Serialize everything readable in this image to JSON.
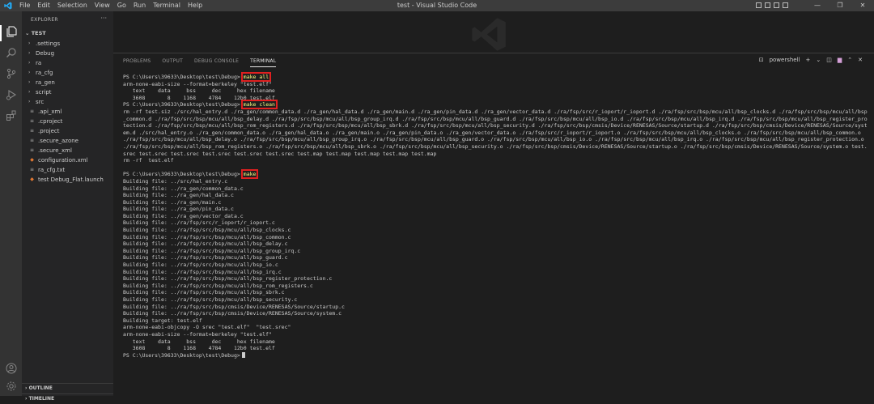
{
  "titlebar": {
    "menu": [
      "File",
      "Edit",
      "Selection",
      "View",
      "Go",
      "Run",
      "Terminal",
      "Help"
    ],
    "title": "test - Visual Studio Code",
    "controls": [
      "—",
      "❐",
      "✕"
    ]
  },
  "activity": {
    "icons": [
      "explorer-icon",
      "search-icon",
      "source-control-icon",
      "run-debug-icon",
      "extensions-icon",
      "accounts-icon",
      "manage-icon"
    ]
  },
  "sidebar": {
    "title": "EXPLORER",
    "more": "···",
    "section": "TEST",
    "items": [
      {
        "label": ".settings",
        "type": "folder"
      },
      {
        "label": "Debug",
        "type": "folder"
      },
      {
        "label": "ra",
        "type": "folder"
      },
      {
        "label": "ra_cfg",
        "type": "folder"
      },
      {
        "label": "ra_gen",
        "type": "folder"
      },
      {
        "label": "script",
        "type": "folder"
      },
      {
        "label": "src",
        "type": "folder"
      },
      {
        "label": ".api_xml",
        "type": "file"
      },
      {
        "label": ".cproject",
        "type": "file"
      },
      {
        "label": ".project",
        "type": "file"
      },
      {
        "label": ".secure_azone",
        "type": "file"
      },
      {
        "label": ".secure_xml",
        "type": "file"
      },
      {
        "label": "configuration.xml",
        "type": "xml"
      },
      {
        "label": "ra_cfg.txt",
        "type": "txt"
      },
      {
        "label": "test Debug_Flat.launch",
        "type": "launch"
      }
    ],
    "outline": "OUTLINE",
    "timeline": "TIMELINE"
  },
  "panel": {
    "tabs": [
      "PROBLEMS",
      "OUTPUT",
      "DEBUG CONSOLE",
      "TERMINAL"
    ],
    "active_tab": "TERMINAL",
    "shell": "powershell",
    "prompt": "PS C:\\Users\\39633\\Desktop\\test\\Debug>",
    "cmd1": "make all",
    "out1": [
      "arm-none-eabi-size --format=berkeley \"test.elf\"",
      "   text    data     bss     dec     hex filename",
      "   3608       8    1168    4784    12b0 test.elf"
    ],
    "cmd2": "make clean",
    "clean_output": "rm -rf test.siz ./src/hal_entry.d ./ra_gen/common_data.d ./ra_gen/hal_data.d ./ra_gen/main.d ./ra_gen/pin_data.d ./ra_gen/vector_data.d ./ra/fsp/src/r_ioport/r_ioport.d ./ra/fsp/src/bsp/mcu/all/bsp_clocks.d ./ra/fsp/src/bsp/mcu/all/bsp_common.d ./ra/fsp/src/bsp/mcu/all/bsp_delay.d ./ra/fsp/src/bsp/mcu/all/bsp_group_irq.d ./ra/fsp/src/bsp/mcu/all/bsp_guard.d ./ra/fsp/src/bsp/mcu/all/bsp_io.d ./ra/fsp/src/bsp/mcu/all/bsp_irq.d ./ra/fsp/src/bsp/mcu/all/bsp_register_protection.d ./ra/fsp/src/bsp/mcu/all/bsp_rom_registers.d ./ra/fsp/src/bsp/mcu/all/bsp_sbrk.d ./ra/fsp/src/bsp/mcu/all/bsp_security.d ./ra/fsp/src/bsp/cmsis/Device/RENESAS/Source/startup.d ./ra/fsp/src/bsp/cmsis/Device/RENESAS/Source/system.d ./src/hal_entry.o ./ra_gen/common_data.o ./ra_gen/hal_data.o ./ra_gen/main.o ./ra_gen/pin_data.o ./ra_gen/vector_data.o ./ra/fsp/src/r_ioport/r_ioport.o ./ra/fsp/src/bsp/mcu/all/bsp_clocks.o ./ra/fsp/src/bsp/mcu/all/bsp_common.o ./ra/fsp/src/bsp/mcu/all/bsp_delay.o ./ra/fsp/src/bsp/mcu/all/bsp_group_irq.o ./ra/fsp/src/bsp/mcu/all/bsp_guard.o ./ra/fsp/src/bsp/mcu/all/bsp_io.o ./ra/fsp/src/bsp/mcu/all/bsp_irq.o ./ra/fsp/src/bsp/mcu/all/bsp_register_protection.o ./ra/fsp/src/bsp/mcu/all/bsp_rom_registers.o ./ra/fsp/src/bsp/mcu/all/bsp_sbrk.o ./ra/fsp/src/bsp/mcu/all/bsp_security.o ./ra/fsp/src/bsp/cmsis/Device/RENESAS/Source/startup.o ./ra/fsp/src/bsp/cmsis/Device/RENESAS/Source/system.o test.srec test.srec test.srec test.srec test.srec test.srec test.map test.map test.map test.map test.map",
    "clean_tail": "rm -rf  test.elf",
    "cmd3": "make",
    "build_lines": [
      "Building file: ../src/hal_entry.c",
      "Building file: ../ra_gen/common_data.c",
      "Building file: ../ra_gen/hal_data.c",
      "Building file: ../ra_gen/main.c",
      "Building file: ../ra_gen/pin_data.c",
      "Building file: ../ra_gen/vector_data.c",
      "Building file: ../ra/fsp/src/r_ioport/r_ioport.c",
      "Building file: ../ra/fsp/src/bsp/mcu/all/bsp_clocks.c",
      "Building file: ../ra/fsp/src/bsp/mcu/all/bsp_common.c",
      "Building file: ../ra/fsp/src/bsp/mcu/all/bsp_delay.c",
      "Building file: ../ra/fsp/src/bsp/mcu/all/bsp_group_irq.c",
      "Building file: ../ra/fsp/src/bsp/mcu/all/bsp_guard.c",
      "Building file: ../ra/fsp/src/bsp/mcu/all/bsp_io.c",
      "Building file: ../ra/fsp/src/bsp/mcu/all/bsp_irq.c",
      "Building file: ../ra/fsp/src/bsp/mcu/all/bsp_register_protection.c",
      "Building file: ../ra/fsp/src/bsp/mcu/all/bsp_rom_registers.c",
      "Building file: ../ra/fsp/src/bsp/mcu/all/bsp_sbrk.c",
      "Building file: ../ra/fsp/src/bsp/mcu/all/bsp_security.c",
      "Building file: ../ra/fsp/src/bsp/cmsis/Device/RENESAS/Source/startup.c",
      "Building file: ../ra/fsp/src/bsp/cmsis/Device/RENESAS/Source/system.c",
      "Building target: test.elf",
      "arm-none-eabi-objcopy -O srec \"test.elf\"  \"test.srec\"",
      "arm-none-eabi-size --format=berkeley \"test.elf\"",
      "   text    data     bss     dec     hex filename",
      "   3608       8    1168    4784    12b0 test.elf"
    ]
  },
  "colors": {
    "highlight_box": "#e02020",
    "command_text": "#ffff80"
  }
}
